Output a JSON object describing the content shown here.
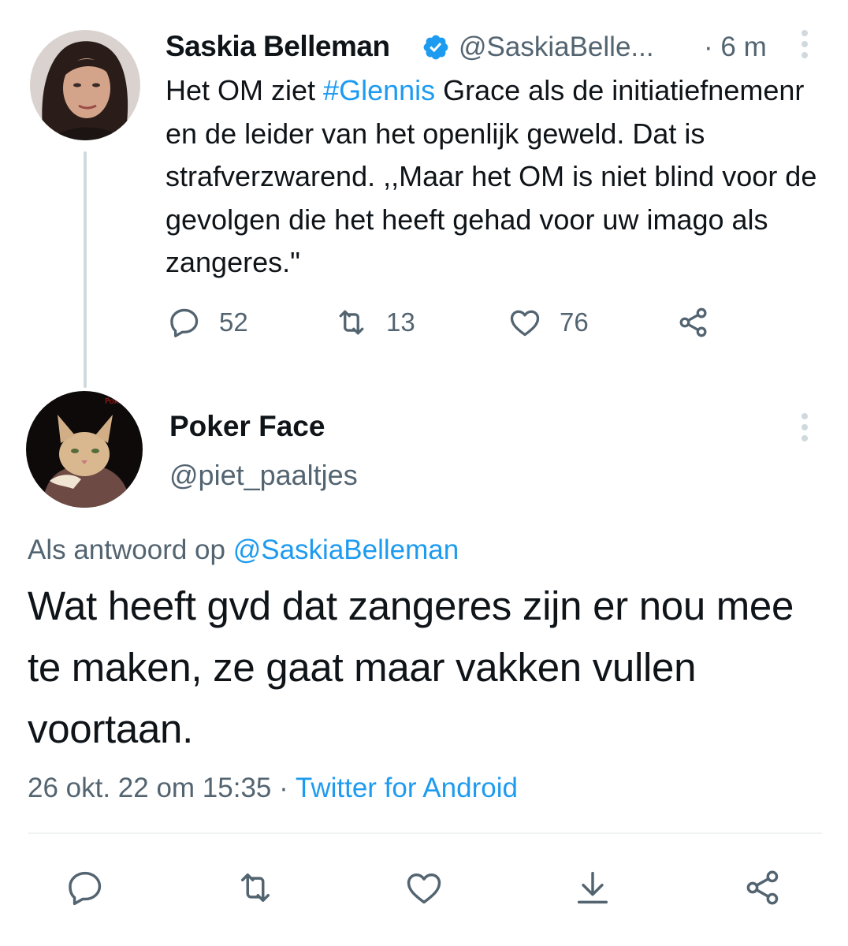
{
  "parent_tweet": {
    "author_name": "Saskia Belleman",
    "handle": "@SaskiaBelle...",
    "time": "· 6 m",
    "text_before_hashtag": "Het OM ziet ",
    "hashtag": "#Glennis",
    "text_after_hashtag": " Grace als de initiatiefnemenr en de leider van het openlijk geweld. Dat is strafverzwarend. ,,Maar het OM is niet blind voor de gevolgen die het heeft gehad voor uw imago als zangeres.\"",
    "replies": "52",
    "retweets": "13",
    "likes": "76"
  },
  "reply_tweet": {
    "author_name": "Poker Face",
    "handle": "@piet_paaltjes",
    "reply_to_label": "Als antwoord op",
    "reply_to_handle": "@SaskiaBelleman",
    "text": "Wat heeft gvd dat zangeres zijn er nou mee te maken, ze gaat maar vakken vullen voortaan.",
    "timestamp": "26 okt. 22 om 15:35",
    "separator": " · ",
    "source": "Twitter for Android"
  },
  "icons": {
    "verified": "verified-badge-icon",
    "more": "more-vertical-icon",
    "reply": "reply-icon",
    "retweet": "retweet-icon",
    "like": "heart-icon",
    "share": "share-icon",
    "bookmark": "download-icon"
  },
  "colors": {
    "accent": "#1d9bf0",
    "text": "#0f1419",
    "secondary": "#536471",
    "thread_line": "#cfd9de"
  }
}
